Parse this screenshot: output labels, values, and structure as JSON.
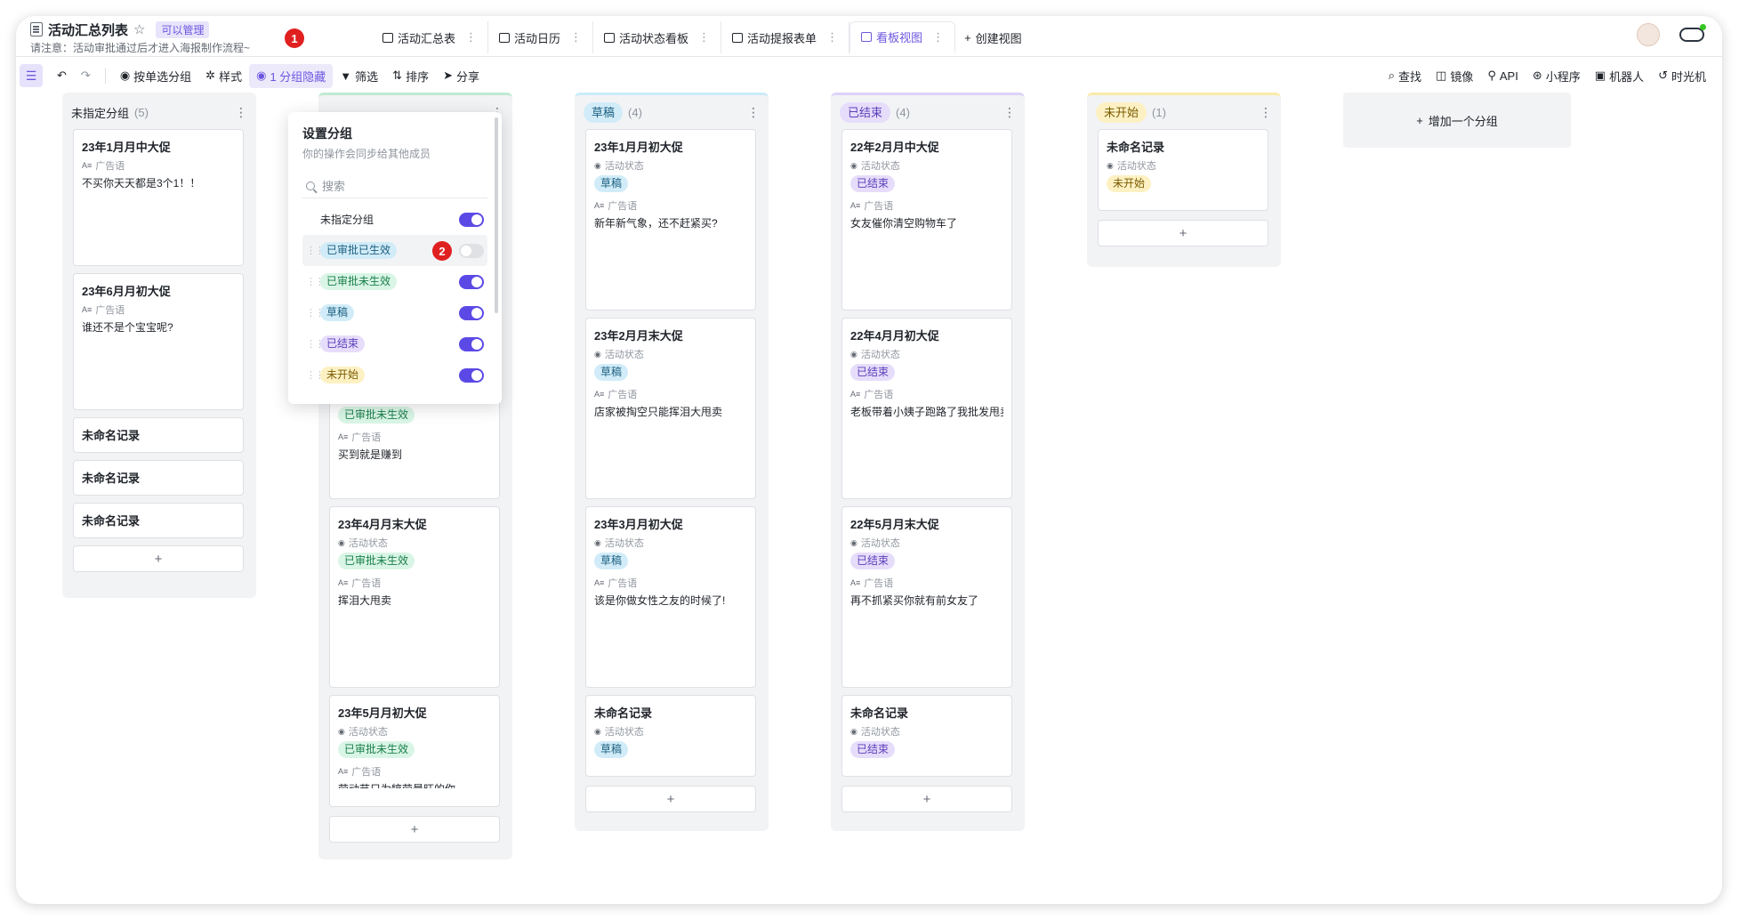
{
  "header": {
    "title": "活动汇总列表",
    "permission": "可以管理",
    "notice": "请注意：活动审批通过后才进入海报制作流程~",
    "marker1": "1",
    "marker2": "2"
  },
  "tabs": [
    {
      "label": "活动汇总表",
      "icon": "table-icon"
    },
    {
      "label": "活动日历",
      "icon": "calendar-icon"
    },
    {
      "label": "活动状态看板",
      "icon": "kanban-icon"
    },
    {
      "label": "活动提报表单",
      "icon": "form-icon"
    },
    {
      "label": "看板视图",
      "icon": "kanban-icon",
      "active": true
    }
  ],
  "create_view": "创建视图",
  "toolbar": {
    "group_by": "按单选分组",
    "style": "样式",
    "hidden": "1 分组隐藏",
    "filter": "筛选",
    "sort": "排序",
    "share": "分享",
    "right": [
      "查找",
      "镜像",
      "API",
      "小程序",
      "机器人",
      "时光机"
    ]
  },
  "colors": {
    "accent": "#5b49e6",
    "published": {
      "bg": "#d9f5e5",
      "fg": "#1a7f4b"
    },
    "draft": {
      "bg": "#d1ecf8",
      "fg": "#1d5f80"
    },
    "ended": {
      "bg": "#e6ddfb",
      "fg": "#5b3fb8"
    },
    "notstarted": {
      "bg": "#fdf1c3",
      "fg": "#7a5a00"
    }
  },
  "labels": {
    "status": "活动状态",
    "slogan": "广告语"
  },
  "groups": [
    {
      "key": "unassigned",
      "name": "未指定分组",
      "count": "(5)",
      "cards": [
        {
          "title": "23年1月月中大促",
          "slogan": "不买你天天都是3个1！！"
        },
        {
          "title": "23年6月月初大促",
          "slogan": "谁还不是个宝宝呢?"
        },
        {
          "title": "未命名记录"
        },
        {
          "title": "未命名记录"
        },
        {
          "title": "未命名记录"
        }
      ]
    },
    {
      "key": "published",
      "name": "已审批未生效",
      "count": "",
      "cards": [
        {
          "title": "",
          "status": "",
          "slogan": ""
        },
        {
          "title": "",
          "status": "已审批未生效",
          "slogan": "买到就是赚到"
        },
        {
          "title": "23年4月月末大促",
          "status": "已审批未生效",
          "slogan": "挥泪大甩卖"
        },
        {
          "title": "23年5月月初大促",
          "status": "已审批未生效",
          "slogan": "劳动节只为犒劳最旺的你"
        }
      ]
    },
    {
      "key": "draft",
      "name": "草稿",
      "count": "(4)",
      "cards": [
        {
          "title": "23年1月月初大促",
          "status": "草稿",
          "slogan": "新年新气象，还不赶紧买?"
        },
        {
          "title": "23年2月月末大促",
          "status": "草稿",
          "slogan": "店家被掏空只能挥泪大甩卖"
        },
        {
          "title": "23年3月月初大促",
          "status": "草稿",
          "slogan": "该是你做女性之友的时候了!"
        },
        {
          "title": "未命名记录",
          "status": "草稿"
        }
      ]
    },
    {
      "key": "ended",
      "name": "已结束",
      "count": "(4)",
      "cards": [
        {
          "title": "22年2月月中大促",
          "status": "已结束",
          "slogan": "女友催你清空购物车了"
        },
        {
          "title": "22年4月月初大促",
          "status": "已结束",
          "slogan": "老板带着小姨子跑路了我批发甩卖"
        },
        {
          "title": "22年5月月末大促",
          "status": "已结束",
          "slogan": "再不抓紧买你就有前女友了"
        },
        {
          "title": "未命名记录",
          "status": "已结束"
        }
      ]
    },
    {
      "key": "notstarted",
      "name": "未开始",
      "count": "(1)",
      "cards": [
        {
          "title": "未命名记录",
          "status": "未开始"
        }
      ]
    }
  ],
  "add_group": "增加一个分组",
  "popover": {
    "title": "设置分组",
    "subtitle": "你的操作会同步给其他成员",
    "search_placeholder": "搜索",
    "rows": [
      {
        "label": "未指定分组",
        "on": true,
        "pill": false
      },
      {
        "label": "已审批已生效",
        "on": false,
        "pill": true,
        "color": "published"
      },
      {
        "label": "已审批未生效",
        "on": true,
        "pill": true,
        "color": "published2"
      },
      {
        "label": "草稿",
        "on": true,
        "pill": true,
        "color": "draft"
      },
      {
        "label": "已结束",
        "on": true,
        "pill": true,
        "color": "ended"
      },
      {
        "label": "未开始",
        "on": true,
        "pill": true,
        "color": "notstarted"
      }
    ]
  }
}
